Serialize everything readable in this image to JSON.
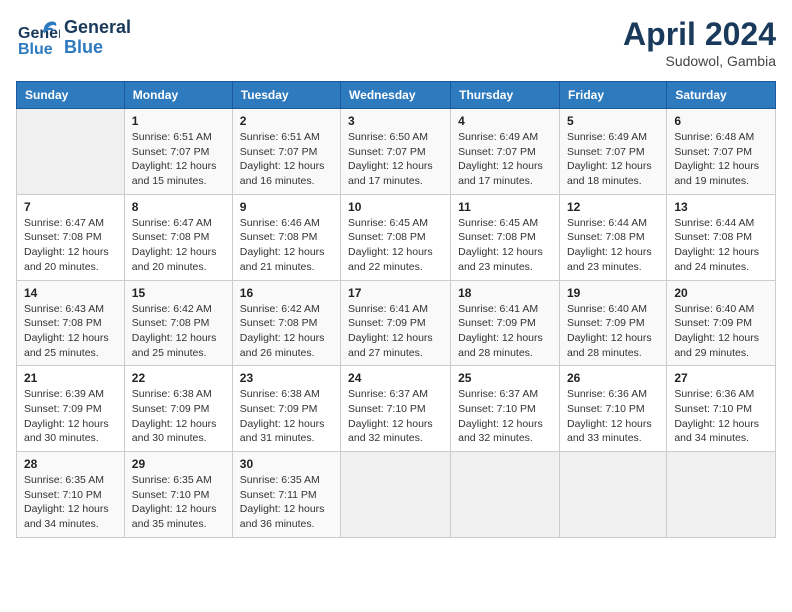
{
  "header": {
    "logo_general": "General",
    "logo_blue": "Blue",
    "month_year": "April 2024",
    "location": "Sudowol, Gambia"
  },
  "calendar": {
    "days_of_week": [
      "Sunday",
      "Monday",
      "Tuesday",
      "Wednesday",
      "Thursday",
      "Friday",
      "Saturday"
    ],
    "weeks": [
      [
        {
          "day": "",
          "info": ""
        },
        {
          "day": "1",
          "info": "Sunrise: 6:51 AM\nSunset: 7:07 PM\nDaylight: 12 hours\nand 15 minutes."
        },
        {
          "day": "2",
          "info": "Sunrise: 6:51 AM\nSunset: 7:07 PM\nDaylight: 12 hours\nand 16 minutes."
        },
        {
          "day": "3",
          "info": "Sunrise: 6:50 AM\nSunset: 7:07 PM\nDaylight: 12 hours\nand 17 minutes."
        },
        {
          "day": "4",
          "info": "Sunrise: 6:49 AM\nSunset: 7:07 PM\nDaylight: 12 hours\nand 17 minutes."
        },
        {
          "day": "5",
          "info": "Sunrise: 6:49 AM\nSunset: 7:07 PM\nDaylight: 12 hours\nand 18 minutes."
        },
        {
          "day": "6",
          "info": "Sunrise: 6:48 AM\nSunset: 7:07 PM\nDaylight: 12 hours\nand 19 minutes."
        }
      ],
      [
        {
          "day": "7",
          "info": "Sunrise: 6:47 AM\nSunset: 7:08 PM\nDaylight: 12 hours\nand 20 minutes."
        },
        {
          "day": "8",
          "info": "Sunrise: 6:47 AM\nSunset: 7:08 PM\nDaylight: 12 hours\nand 20 minutes."
        },
        {
          "day": "9",
          "info": "Sunrise: 6:46 AM\nSunset: 7:08 PM\nDaylight: 12 hours\nand 21 minutes."
        },
        {
          "day": "10",
          "info": "Sunrise: 6:45 AM\nSunset: 7:08 PM\nDaylight: 12 hours\nand 22 minutes."
        },
        {
          "day": "11",
          "info": "Sunrise: 6:45 AM\nSunset: 7:08 PM\nDaylight: 12 hours\nand 23 minutes."
        },
        {
          "day": "12",
          "info": "Sunrise: 6:44 AM\nSunset: 7:08 PM\nDaylight: 12 hours\nand 23 minutes."
        },
        {
          "day": "13",
          "info": "Sunrise: 6:44 AM\nSunset: 7:08 PM\nDaylight: 12 hours\nand 24 minutes."
        }
      ],
      [
        {
          "day": "14",
          "info": "Sunrise: 6:43 AM\nSunset: 7:08 PM\nDaylight: 12 hours\nand 25 minutes."
        },
        {
          "day": "15",
          "info": "Sunrise: 6:42 AM\nSunset: 7:08 PM\nDaylight: 12 hours\nand 25 minutes."
        },
        {
          "day": "16",
          "info": "Sunrise: 6:42 AM\nSunset: 7:08 PM\nDaylight: 12 hours\nand 26 minutes."
        },
        {
          "day": "17",
          "info": "Sunrise: 6:41 AM\nSunset: 7:09 PM\nDaylight: 12 hours\nand 27 minutes."
        },
        {
          "day": "18",
          "info": "Sunrise: 6:41 AM\nSunset: 7:09 PM\nDaylight: 12 hours\nand 28 minutes."
        },
        {
          "day": "19",
          "info": "Sunrise: 6:40 AM\nSunset: 7:09 PM\nDaylight: 12 hours\nand 28 minutes."
        },
        {
          "day": "20",
          "info": "Sunrise: 6:40 AM\nSunset: 7:09 PM\nDaylight: 12 hours\nand 29 minutes."
        }
      ],
      [
        {
          "day": "21",
          "info": "Sunrise: 6:39 AM\nSunset: 7:09 PM\nDaylight: 12 hours\nand 30 minutes."
        },
        {
          "day": "22",
          "info": "Sunrise: 6:38 AM\nSunset: 7:09 PM\nDaylight: 12 hours\nand 30 minutes."
        },
        {
          "day": "23",
          "info": "Sunrise: 6:38 AM\nSunset: 7:09 PM\nDaylight: 12 hours\nand 31 minutes."
        },
        {
          "day": "24",
          "info": "Sunrise: 6:37 AM\nSunset: 7:10 PM\nDaylight: 12 hours\nand 32 minutes."
        },
        {
          "day": "25",
          "info": "Sunrise: 6:37 AM\nSunset: 7:10 PM\nDaylight: 12 hours\nand 32 minutes."
        },
        {
          "day": "26",
          "info": "Sunrise: 6:36 AM\nSunset: 7:10 PM\nDaylight: 12 hours\nand 33 minutes."
        },
        {
          "day": "27",
          "info": "Sunrise: 6:36 AM\nSunset: 7:10 PM\nDaylight: 12 hours\nand 34 minutes."
        }
      ],
      [
        {
          "day": "28",
          "info": "Sunrise: 6:35 AM\nSunset: 7:10 PM\nDaylight: 12 hours\nand 34 minutes."
        },
        {
          "day": "29",
          "info": "Sunrise: 6:35 AM\nSunset: 7:10 PM\nDaylight: 12 hours\nand 35 minutes."
        },
        {
          "day": "30",
          "info": "Sunrise: 6:35 AM\nSunset: 7:11 PM\nDaylight: 12 hours\nand 36 minutes."
        },
        {
          "day": "",
          "info": ""
        },
        {
          "day": "",
          "info": ""
        },
        {
          "day": "",
          "info": ""
        },
        {
          "day": "",
          "info": ""
        }
      ]
    ]
  }
}
